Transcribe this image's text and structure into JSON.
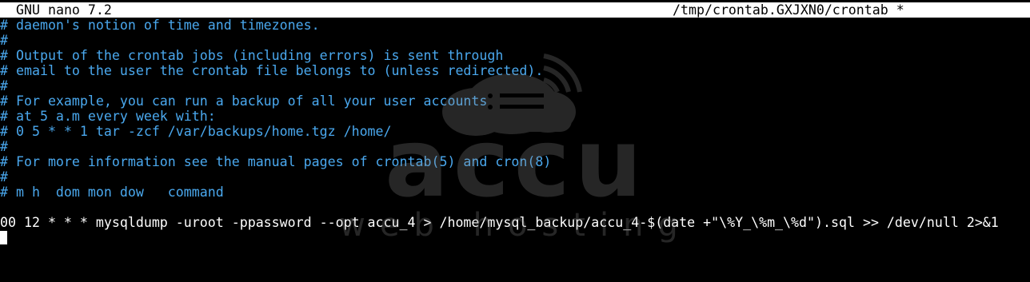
{
  "titlebar": {
    "app_version": "GNU nano 7.2",
    "file_path": "/tmp/crontab.GXJXN0/crontab *"
  },
  "editor": {
    "lines": [
      {
        "text": "# daemon's notion of time and timezones.",
        "kind": "comment"
      },
      {
        "text": "#",
        "kind": "comment"
      },
      {
        "text": "# Output of the crontab jobs (including errors) is sent through",
        "kind": "comment"
      },
      {
        "text": "# email to the user the crontab file belongs to (unless redirected).",
        "kind": "comment"
      },
      {
        "text": "#",
        "kind": "comment"
      },
      {
        "text": "# For example, you can run a backup of all your user accounts",
        "kind": "comment"
      },
      {
        "text": "# at 5 a.m every week with:",
        "kind": "comment"
      },
      {
        "text": "# 0 5 * * 1 tar -zcf /var/backups/home.tgz /home/",
        "kind": "comment"
      },
      {
        "text": "#",
        "kind": "comment"
      },
      {
        "text": "# For more information see the manual pages of crontab(5) and cron(8)",
        "kind": "comment"
      },
      {
        "text": "#",
        "kind": "comment"
      },
      {
        "text": "# m h  dom mon dow   command",
        "kind": "comment"
      },
      {
        "text": "",
        "kind": "blank"
      },
      {
        "text": "00 12 * * * mysqldump -uroot -ppassword --opt accu_4 > /home/mysql_backup/accu_4-$(date +\"\\%Y_\\%m_\\%d\").sql >> /dev/null 2>&1",
        "kind": "code"
      }
    ]
  },
  "watermark": {
    "brand": "accu",
    "tagline": "web hosting"
  },
  "colors": {
    "background": "#000000",
    "comment": "#4aa8ee",
    "text": "#ffffff",
    "titlebar_bg": "#ffffff",
    "titlebar_fg": "#000000"
  }
}
